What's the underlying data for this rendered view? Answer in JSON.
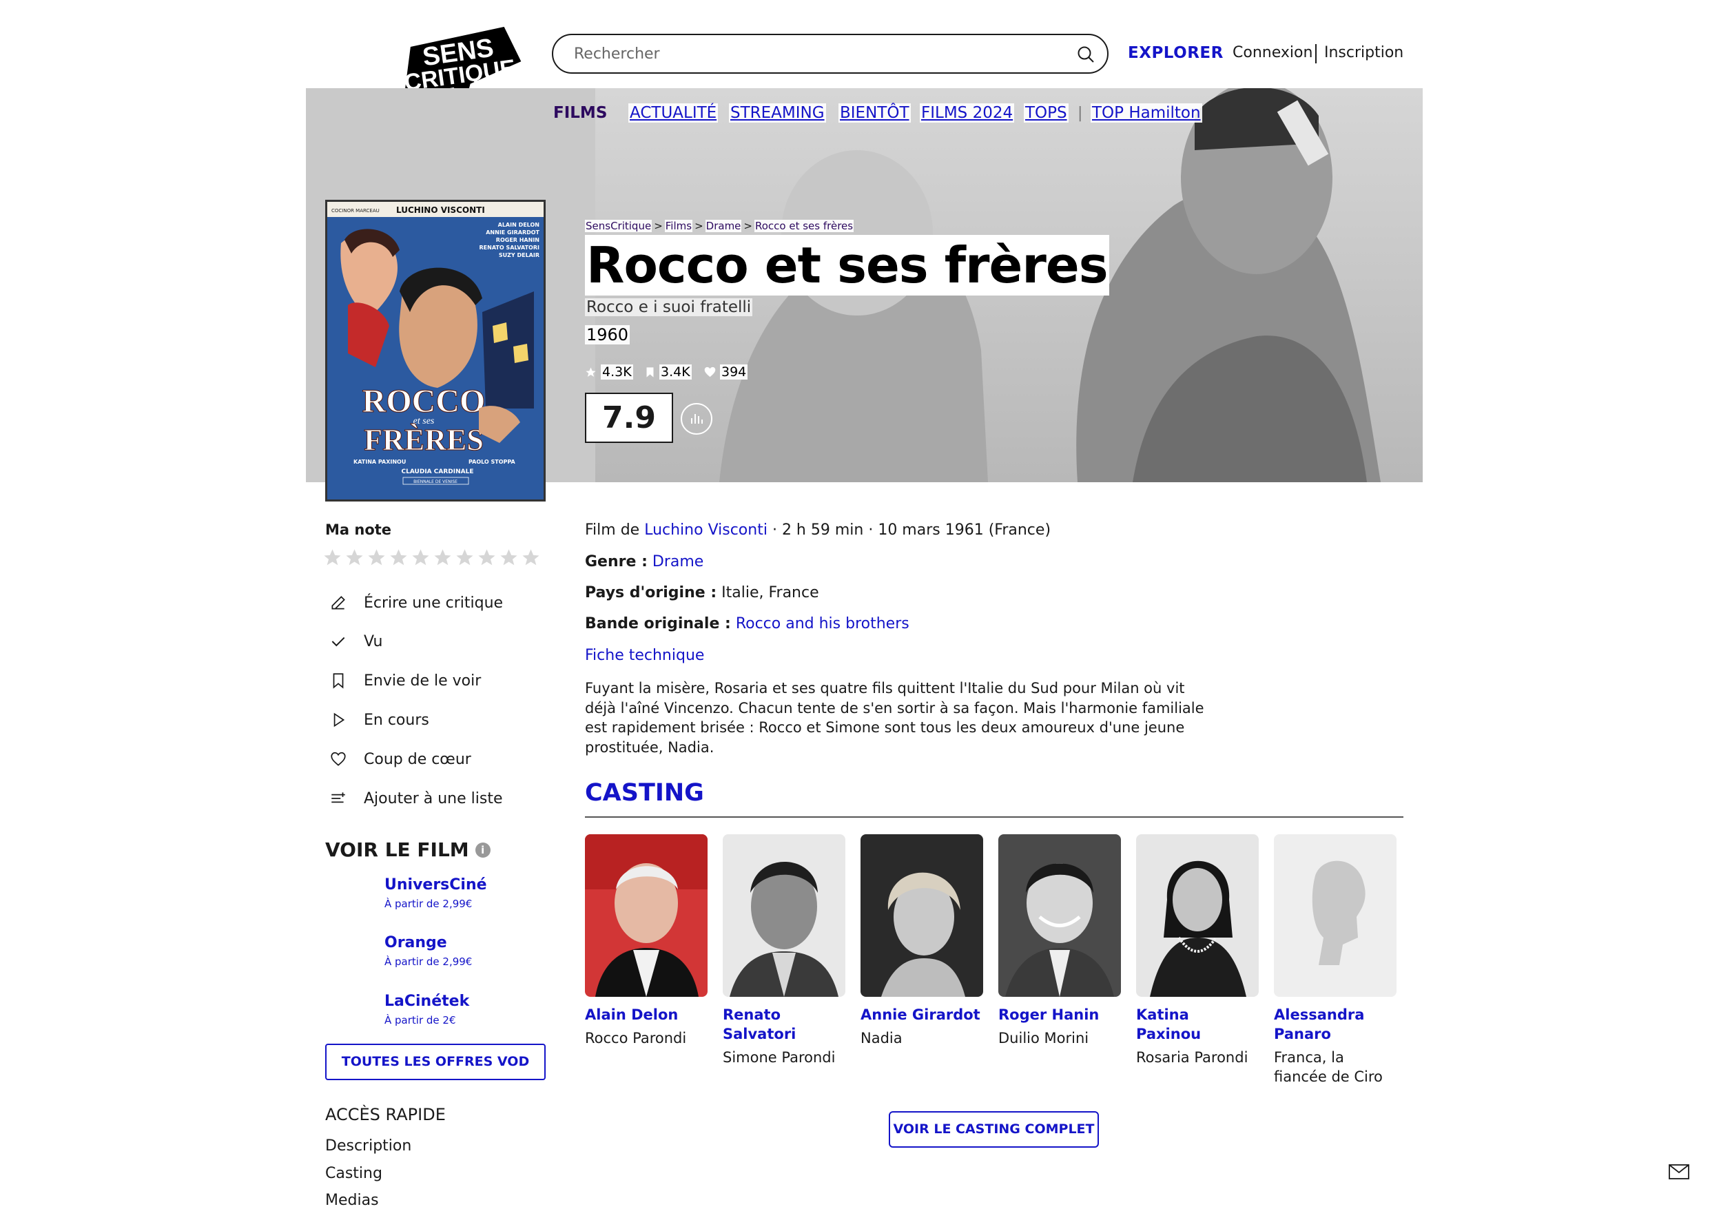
{
  "header": {
    "logo_text": [
      "SENS",
      "CRITIQUE"
    ],
    "search_placeholder": "Rechercher",
    "explorer": "EXPLORER",
    "connexion": "Connexion",
    "inscription": "Inscription"
  },
  "nav": {
    "films": "FILMS",
    "items": [
      "ACTUALITÉ",
      "STREAMING",
      "BIENTÔT",
      "FILMS 2024",
      "TOPS"
    ],
    "separator": "|",
    "top": "TOP Hamilton"
  },
  "poster": {
    "credit": "COCINOR MARCEAU",
    "director": "LUCHINO VISCONTI",
    "cast_lines": [
      "ALAIN DELON",
      "ANNIE GIRARDOT",
      "ROGER HANIN",
      "RENATO SALVATORI",
      "SUZY DELAIR"
    ],
    "title_line1": "ROCCO",
    "title_line2": "et ses",
    "title_line3": "FRÈRES",
    "bottom_line1": "KATINA PAXINOU",
    "bottom_line2": "PAOLO STOPPA",
    "bottom_line3": "CLAUDIA CARDINALE",
    "bottom_line4": "BIENNALE DE VENISE"
  },
  "breadcrumb": [
    "SensCritique",
    "Films",
    "Drame",
    "Rocco et ses frères"
  ],
  "breadcrumb_sep": ">",
  "film": {
    "title": "Rocco et ses frères",
    "original_title": "Rocco e i suoi fratelli",
    "year": "1960",
    "stats": {
      "ratings": "4.3K",
      "wishlist": "3.4K",
      "likes": "394"
    },
    "score": "7.9"
  },
  "sidebar": {
    "ma_note": "Ma note",
    "stars_count": 10,
    "actions": [
      "Écrire une critique",
      "Vu",
      "Envie de le voir",
      "En cours",
      "Coup de cœur",
      "Ajouter à une liste"
    ],
    "voir_le_film": "VOIR LE FILM",
    "info_glyph": "i",
    "vod": [
      {
        "name": "UniversCiné",
        "price": "À partir de 2,99€"
      },
      {
        "name": "Orange",
        "price": "À partir de 2,99€"
      },
      {
        "name": "LaCinétek",
        "price": "À partir de 2€"
      }
    ],
    "vod_all": "TOUTES LES OFFRES VOD",
    "acces_rapide": "ACCÈS RAPIDE",
    "quick_links": [
      "Description",
      "Casting",
      "Medias"
    ]
  },
  "details": {
    "film_de_label": "Film de",
    "director": "Luchino Visconti",
    "duration_date": "· 2 h 59 min · 10 mars 1961 (France)",
    "genre_label": "Genre :",
    "genre": "Drame",
    "pays_label": "Pays d'origine :",
    "pays": "Italie, France",
    "bande_label": "Bande originale :",
    "bande": "Rocco and his brothers",
    "fiche": "Fiche technique",
    "synopsis": "Fuyant la misère, Rosaria et ses quatre fils quittent l'Italie du Sud pour Milan où vit déjà l'aîné Vincenzo. Chacun tente de s'en sortir à sa façon. Mais l'harmonie familiale est rapidement brisée : Rocco et Simone sont tous les deux amoureux d'une jeune prostituée, Nadia."
  },
  "casting": {
    "title": "CASTING",
    "members": [
      {
        "name": "Alain Delon",
        "role": "Rocco Parondi"
      },
      {
        "name": "Renato Salvatori",
        "role": "Simone Parondi"
      },
      {
        "name": "Annie Girardot",
        "role": "Nadia"
      },
      {
        "name": "Roger Hanin",
        "role": "Duilio Morini"
      },
      {
        "name": "Katina Paxinou",
        "role": "Rosaria Parondi"
      },
      {
        "name": "Alessandra Panaro",
        "role": "Franca, la fiancée de Ciro"
      }
    ],
    "see_all": "VOIR LE CASTING COMPLET"
  },
  "colors": {
    "accent": "#1414c8",
    "nav_active": "#2d0a5f",
    "text": "#1a1a1a"
  }
}
